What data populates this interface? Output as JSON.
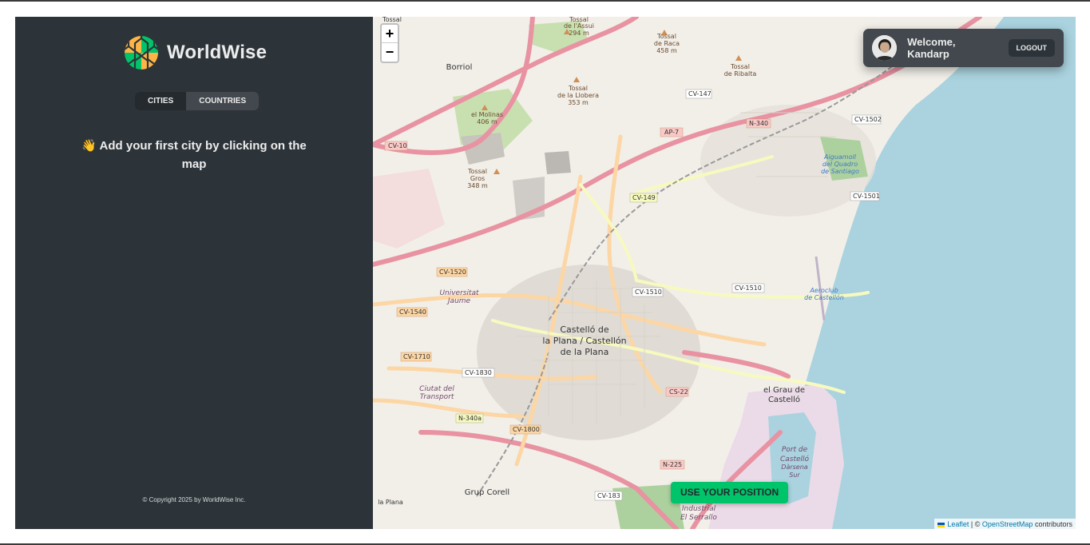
{
  "app": {
    "name": "WorldWise"
  },
  "sidebar": {
    "tabs": [
      {
        "label": "Cities",
        "active": true
      },
      {
        "label": "Countries",
        "active": false
      }
    ],
    "message": "👋 Add your first city by clicking on the map",
    "footer": "© Copyright 2025 by WorldWise Inc."
  },
  "map": {
    "zoom_in": "+",
    "zoom_out": "−",
    "use_position": "Use your position",
    "attribution": {
      "leaflet": "Leaflet",
      "separator": "| ©",
      "osm": "OpenStreetMap",
      "suffix": "contributors"
    },
    "labels": {
      "city": [
        "Castelló de",
        "la Plana / Castellón",
        "de la Plana"
      ],
      "grau": [
        "el Grau de",
        "Castelló"
      ],
      "borriol": "Borriol",
      "grup_corell": "Grup Corell",
      "molinas": [
        "el Molinas",
        "406 m"
      ],
      "tossal_gros": [
        "Tossal",
        "Gros",
        "348 m"
      ],
      "tossal_llobera": [
        "Tossal",
        "de la Llobera",
        "353 m"
      ],
      "tossal_assui": [
        "Tossal",
        "de l'Assui",
        "294 m"
      ],
      "tossal_raca": [
        "Tossal",
        "de Raca",
        "458 m"
      ],
      "tossal_ribalta": [
        "Tossal",
        "de Ribalta"
      ],
      "tossal_top": "Tossal",
      "port": [
        "Port de",
        "Castelló",
        "Dàrsena",
        "Sur"
      ],
      "aeroclub": [
        "Aeroclub",
        "de Castellón"
      ],
      "aiguamoll": [
        "Aiguamoll",
        "del Quadro",
        "de Santiago"
      ],
      "universitat": [
        "Universitat",
        "Jaume"
      ],
      "ciutat_transport": [
        "Ciutat del",
        "Transport"
      ],
      "industrial": [
        "Industrial",
        "El Serrallo"
      ],
      "la_plana": "la Plana",
      "roads": [
        "CV-10",
        "AP-7",
        "N-340",
        "CV-147",
        "CV-1502",
        "CV-1501",
        "CV-149",
        "CV-1520",
        "CV-1510",
        "CV-1540",
        "CV-1710",
        "CV-1830",
        "N-340a",
        "CV-1800",
        "CS-22",
        "N-225",
        "CV-183"
      ]
    }
  },
  "user": {
    "welcome": "Welcome, Kandarp",
    "logout": "Logout"
  },
  "colors": {
    "sidebar": "#2d3439",
    "panel": "#42484d",
    "brand_green": "#00c46a",
    "brand_orange": "#ffb545",
    "sea": "#aad3df"
  }
}
